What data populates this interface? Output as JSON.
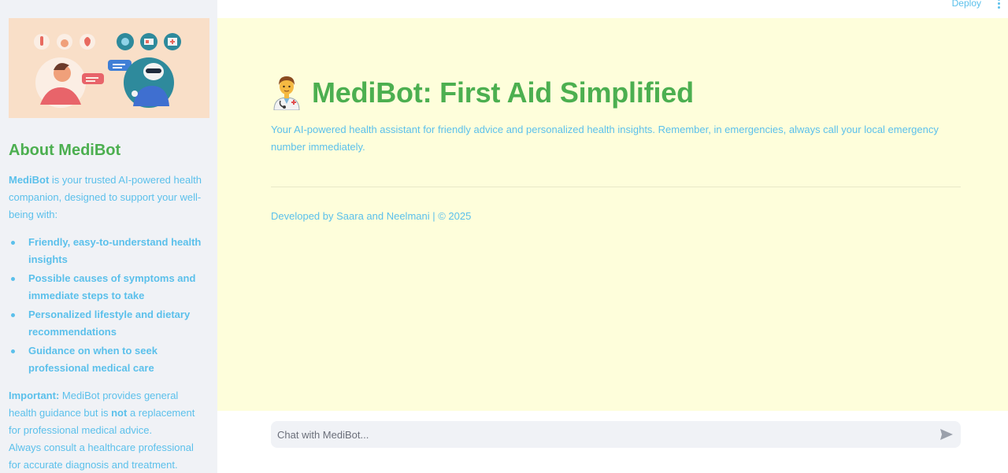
{
  "topbar": {
    "deploy_label": "Deploy"
  },
  "sidebar": {
    "about_title": "About MediBot",
    "intro_brand": "MediBot",
    "intro_text": " is your trusted AI-powered health companion, designed to support your well-being with:",
    "features": [
      "Friendly, easy-to-understand health insights",
      "Possible causes of symptoms and immediate steps to take",
      "Personalized lifestyle and dietary recommendations",
      "Guidance on when to seek professional medical care"
    ],
    "important_label": "Important:",
    "important_text_1": " MediBot provides general health guidance but is ",
    "important_not": "not",
    "important_text_2": " a replacement for professional medical advice.",
    "important_text_3": "Always consult a healthcare professional for accurate diagnosis and treatment."
  },
  "main": {
    "title": "MediBot: First Aid Simplified",
    "subtitle": "Your AI-powered health assistant for friendly advice and personalized health insights. Remember, in emergencies, always call your local emergency number immediately.",
    "credit": "Developed by Saara and Neelmani | © 2025"
  },
  "chat": {
    "placeholder": "Chat with MediBot..."
  },
  "icons": {
    "doctor": "health-worker-icon",
    "send": "send-icon",
    "menu": "kebab-menu-icon"
  },
  "colors": {
    "accent_green": "#4caf50",
    "text_blue": "#5bc0eb",
    "main_bg": "#fefedb",
    "sidebar_bg": "#f0f2f6"
  }
}
